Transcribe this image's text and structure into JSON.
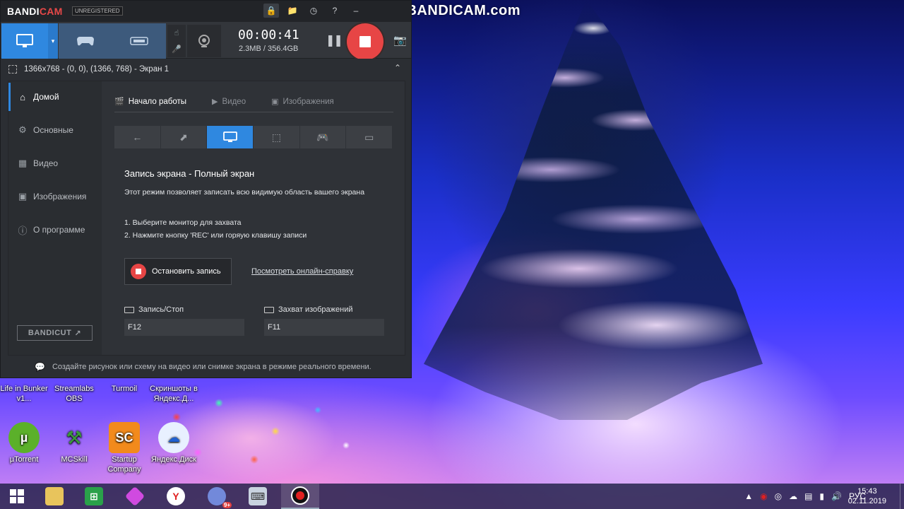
{
  "watermark": "www.BANDICAM.com",
  "app": {
    "brand_main": "BANDI",
    "brand_cam": "CAM",
    "badge": "UNREGISTERED",
    "timer": "00:00:41",
    "size": "2.3MB / 356.4GB",
    "area": "1366x768 - (0, 0), (1366, 768) - Экран 1",
    "accent_color": "#2f88e0",
    "record_color": "#e74545"
  },
  "sidebar": {
    "items": [
      {
        "label": "Домой",
        "icon": "home-icon"
      },
      {
        "label": "Основные",
        "icon": "gear-icon"
      },
      {
        "label": "Видео",
        "icon": "video-icon"
      },
      {
        "label": "Изображения",
        "icon": "image-icon"
      },
      {
        "label": "О программе",
        "icon": "info-icon"
      }
    ],
    "bandicut": "BANDICUT"
  },
  "tabs": [
    {
      "label": "Начало работы"
    },
    {
      "label": "Видео"
    },
    {
      "label": "Изображения"
    }
  ],
  "main": {
    "heading": "Запись экрана - Полный экран",
    "description": "Этот режим позволяет записать всю видимую область вашего экрана",
    "step1": "1. Выберите монитор для захвата",
    "step2": "2. Нажмите кнопку 'REC' или горяую клавишу записи",
    "stop_button": "Остановить запись",
    "help_link": "Посмотреть онлайн-справку",
    "hotkey_record_label": "Запись/Стоп",
    "hotkey_record_value": "F12",
    "hotkey_image_label": "Захват изображений",
    "hotkey_image_value": "F11"
  },
  "footer": "Создайте рисунок или схему на видео или снимке экрана в режиме реального времени.",
  "desktop_icons": [
    {
      "label": "Life in Bunker v1..."
    },
    {
      "label": "Streamlabs OBS"
    },
    {
      "label": "Turmoil"
    },
    {
      "label": "Скриншоты в Яндекс.Д..."
    },
    {
      "label": "µTorrent"
    },
    {
      "label": "MCSkill"
    },
    {
      "label": "Startup Company"
    },
    {
      "label": "Яндекс.Диск"
    }
  ],
  "taskbar": {
    "lang": "РУС",
    "time": "15:43",
    "date": "02.11.2019",
    "discord_badge": "9+"
  }
}
